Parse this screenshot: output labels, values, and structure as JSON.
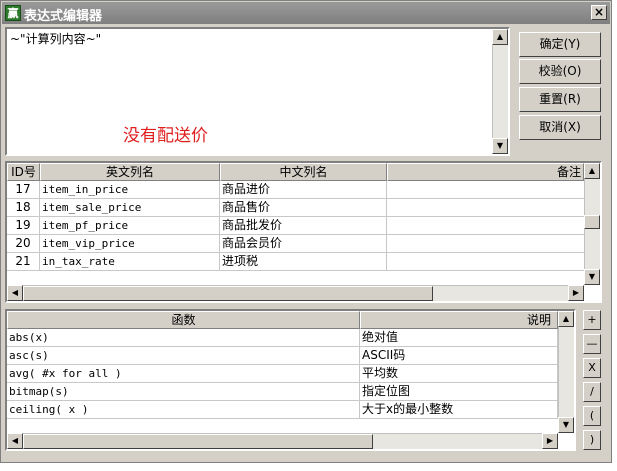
{
  "window": {
    "title": "表达式编辑器",
    "app_icon_glyph": "赢",
    "close_glyph": "×"
  },
  "editor": {
    "content": "~\"计算列内容~\"",
    "note": "没有配送价",
    "note_color": "#e02020"
  },
  "buttons": {
    "confirm": "确定(Y)",
    "verify": "校验(O)",
    "reset": "重置(R)",
    "cancel": "取消(X)"
  },
  "columns_table": {
    "headers": [
      "ID号",
      "英文列名",
      "中文列名",
      "备注"
    ],
    "rows": [
      {
        "id": "17",
        "en": "item_in_price",
        "cn": "商品进价"
      },
      {
        "id": "18",
        "en": "item_sale_price",
        "cn": "商品售价"
      },
      {
        "id": "19",
        "en": "item_pf_price",
        "cn": "商品批发价"
      },
      {
        "id": "20",
        "en": "item_vip_price",
        "cn": "商品会员价"
      },
      {
        "id": "21",
        "en": "in_tax_rate",
        "cn": "进项税"
      }
    ]
  },
  "functions_table": {
    "headers": [
      "函数",
      "说明"
    ],
    "rows": [
      {
        "fn": "abs(x)",
        "desc": "绝对值"
      },
      {
        "fn": "asc(s)",
        "desc": "ASCII码"
      },
      {
        "fn": "avg( #x for all )",
        "desc": "平均数"
      },
      {
        "fn": "bitmap(s)",
        "desc": "指定位图"
      },
      {
        "fn": "ceiling( x )",
        "desc": "大于x的最小整数"
      }
    ]
  },
  "operators": [
    "+",
    "—",
    "X",
    "/",
    "(",
    ")"
  ],
  "scroll_glyphs": {
    "up": "▲",
    "down": "▼",
    "left": "◀",
    "right": "▶"
  }
}
